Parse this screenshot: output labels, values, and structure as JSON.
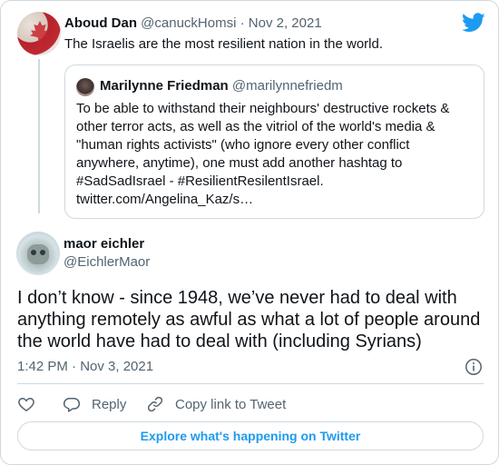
{
  "parent_tweet": {
    "author_name": "Aboud Dan",
    "author_handle": "@canuckHomsi",
    "separator": "·",
    "date": "Nov 2, 2021",
    "text": "The Israelis are the most resilient nation in the world."
  },
  "quoted_tweet": {
    "author_name": "Marilynne Friedman",
    "author_handle": "@marilynnefriedm",
    "text_lines": [
      "To be able to withstand their neighbours' destructive rockets &",
      "other terror acts, as well as the vitriol of the world's media &",
      "\"human rights activists\" (who ignore every other conflict",
      "anywhere, anytime), one must add another hashtag to",
      "#SadSadIsrael - #ResilientResilentIsrael.",
      "twitter.com/Angelina_Kaz/s…"
    ]
  },
  "main_tweet": {
    "author_name": "maor eichler",
    "author_handle": "@EichlerMaor",
    "text_lines": [
      "I don’t know - since 1948, we’ve never had to deal with",
      "anything remotely as awful as what a lot of people around",
      "the world have had to deal with (including Syrians)"
    ],
    "timestamp": "1:42 PM · Nov 3, 2021"
  },
  "actions": {
    "reply_label": "Reply",
    "copy_link_label": "Copy link to Tweet"
  },
  "explore_label": "Explore what's happening on Twitter",
  "colors": {
    "twitter_blue": "#1d9bf0",
    "muted_text": "#536471",
    "border": "#cfd9de"
  },
  "icons": [
    "twitter-bird-icon",
    "info-icon",
    "heart-icon",
    "reply-icon",
    "link-icon"
  ]
}
